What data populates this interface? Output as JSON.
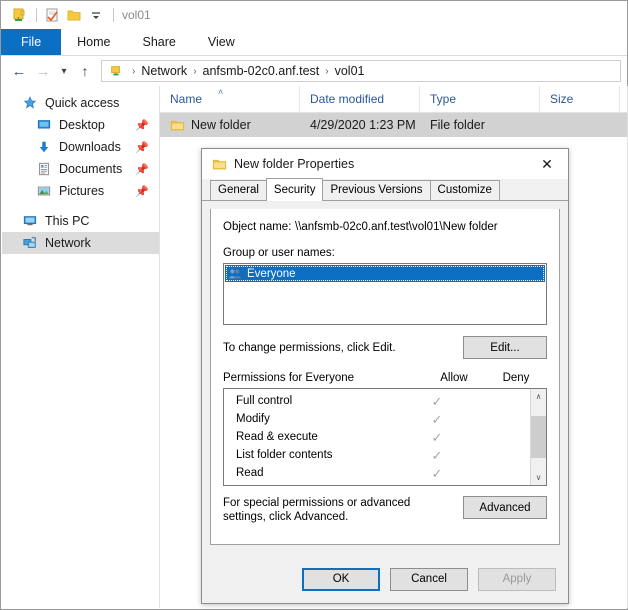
{
  "window": {
    "title": "vol01",
    "quick_access_icons": [
      "folder-pin-icon",
      "properties-checkmark-icon",
      "folder-icon",
      "customize-dropdown-icon"
    ]
  },
  "ribbon": {
    "tabs": [
      {
        "label": "File",
        "icon": "file-tab",
        "active": true
      },
      {
        "label": "Home",
        "icon": "home-tab",
        "active": false
      },
      {
        "label": "Share",
        "icon": "share-tab",
        "active": false
      },
      {
        "label": "View",
        "icon": "view-tab",
        "active": false
      }
    ],
    "file_tab_color": "#0b6fc4"
  },
  "address_bar": {
    "back_icon": "arrow-left-icon",
    "forward_icon": "arrow-right-icon",
    "recent_icon": "chevron-down-icon",
    "up_icon": "arrow-up-icon",
    "path_icon": "network-computer-icon",
    "crumbs": [
      "Network",
      "anfsmb-02c0.anf.test",
      "vol01"
    ],
    "separator": "›"
  },
  "sidebar": {
    "items": [
      {
        "label": "Quick access",
        "icon": "star-icon",
        "indent": false,
        "pinned": false,
        "selected": false
      },
      {
        "label": "Desktop",
        "icon": "desktop-icon",
        "indent": true,
        "pinned": true,
        "selected": false
      },
      {
        "label": "Downloads",
        "icon": "downloads-arrow-icon",
        "indent": true,
        "pinned": true,
        "selected": false
      },
      {
        "label": "Documents",
        "icon": "documents-icon",
        "indent": true,
        "pinned": true,
        "selected": false
      },
      {
        "label": "Pictures",
        "icon": "pictures-icon",
        "indent": true,
        "pinned": true,
        "selected": false
      },
      {
        "label": "This PC",
        "icon": "this-pc-icon",
        "indent": false,
        "pinned": false,
        "selected": false
      },
      {
        "label": "Network",
        "icon": "network-icon",
        "indent": false,
        "pinned": false,
        "selected": true
      }
    ],
    "pin_glyph": "📌"
  },
  "file_list": {
    "columns": [
      {
        "label": "Name",
        "sorted": true,
        "sort_glyph": "˄"
      },
      {
        "label": "Date modified",
        "sorted": false
      },
      {
        "label": "Type",
        "sorted": false
      },
      {
        "label": "Size",
        "sorted": false
      }
    ],
    "rows": [
      {
        "name": "New folder",
        "date_modified": "4/29/2020 1:23 PM",
        "type": "File folder",
        "size": "",
        "icon": "folder-icon",
        "selected": true
      }
    ]
  },
  "dialog": {
    "title": "New folder Properties",
    "title_icon": "folder-icon",
    "close_icon": "close-icon",
    "tabs": [
      {
        "label": "General",
        "active": false
      },
      {
        "label": "Security",
        "active": true
      },
      {
        "label": "Previous Versions",
        "active": false
      },
      {
        "label": "Customize",
        "active": false
      }
    ],
    "object_name_label": "Object name:",
    "object_name_value": "\\\\anfsmb-02c0.anf.test\\vol01\\New folder",
    "group_label": "Group or user names:",
    "group_list": [
      {
        "name": "Everyone",
        "icon": "users-group-icon",
        "selected": true
      }
    ],
    "change_hint": "To change permissions, click Edit.",
    "edit_button": "Edit...",
    "permissions_label": "Permissions for Everyone",
    "allow_header": "Allow",
    "deny_header": "Deny",
    "check_glyph": "✓",
    "permissions": [
      {
        "name": "Full control",
        "allow": true,
        "deny": false
      },
      {
        "name": "Modify",
        "allow": true,
        "deny": false
      },
      {
        "name": "Read & execute",
        "allow": true,
        "deny": false
      },
      {
        "name": "List folder contents",
        "allow": true,
        "deny": false
      },
      {
        "name": "Read",
        "allow": true,
        "deny": false
      }
    ],
    "scroll_up_glyph": "∧",
    "scroll_down_glyph": "∨",
    "advanced_hint": "For special permissions or advanced settings, click Advanced.",
    "advanced_button": "Advanced",
    "footer": {
      "ok": "OK",
      "cancel": "Cancel",
      "apply": "Apply",
      "apply_disabled": true,
      "default_button": "OK"
    },
    "accent_color": "#0b6fc4"
  }
}
